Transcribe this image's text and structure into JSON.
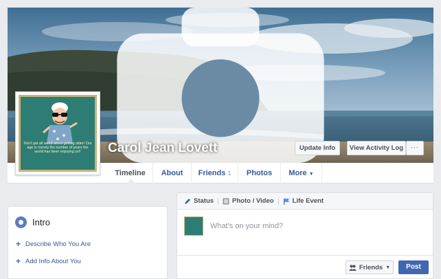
{
  "profile": {
    "name": "Carol Jean Lovett",
    "picture_caption": "Don't get all weird about getting older! Our age is merely the number of years the world has been enjoying us!!"
  },
  "cover_actions": {
    "update_info": "Update Info",
    "activity_log": "View Activity Log",
    "more": "···"
  },
  "nav": {
    "timeline": "Timeline",
    "about": "About",
    "friends": "Friends",
    "friends_count": "1",
    "photos": "Photos",
    "more": "More",
    "more_caret": "▼"
  },
  "intro": {
    "title": "Intro",
    "links": [
      "Describe Who You Are",
      "Add Info About You"
    ]
  },
  "composer": {
    "tabs": [
      "Status",
      "Photo / Video",
      "Life Event"
    ],
    "placeholder": "What's on your mind?",
    "audience": "Friends",
    "audience_caret": "▼",
    "post": "Post"
  },
  "colors": {
    "accent": "#4267b2",
    "link": "#365899",
    "background": "#e9ebee"
  },
  "icons": [
    "camera-icon",
    "globe-icon",
    "pencil-icon",
    "photo-icon",
    "flag-icon",
    "friends-icon",
    "plus-icon"
  ]
}
